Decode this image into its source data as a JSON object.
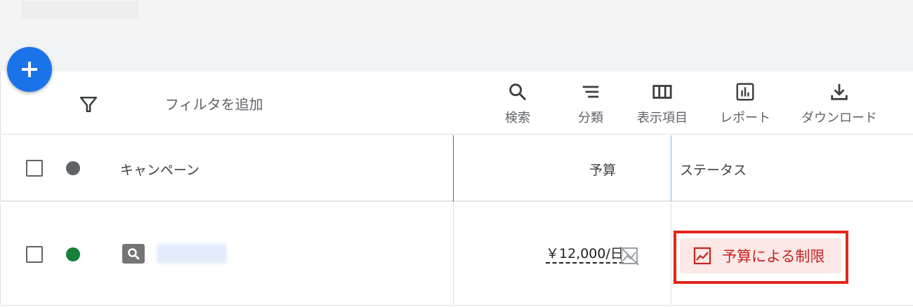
{
  "toolbar": {
    "filter_placeholder": "フィルタを追加",
    "tools": [
      {
        "label": "検索",
        "icon": "search-icon"
      },
      {
        "label": "分類",
        "icon": "segment-icon"
      },
      {
        "label": "表示項目",
        "icon": "columns-icon"
      },
      {
        "label": "レポート",
        "icon": "report-icon"
      },
      {
        "label": "ダウンロード",
        "icon": "download-icon"
      }
    ]
  },
  "table": {
    "headers": {
      "campaign": "キャンペーン",
      "budget": "予算",
      "status": "ステータス"
    },
    "rows": [
      {
        "status_dot_color": "#188038",
        "campaign_type_icon": "search-campaign-icon",
        "budget": "￥12,000/日",
        "status": "予算による制限"
      }
    ]
  },
  "colors": {
    "accent": "#1a73e8",
    "header_dot": "#5f6368",
    "status_limited_bg": "#fce8e6",
    "status_limited_text": "#c5221f",
    "highlight_outline": "#e1261c"
  }
}
